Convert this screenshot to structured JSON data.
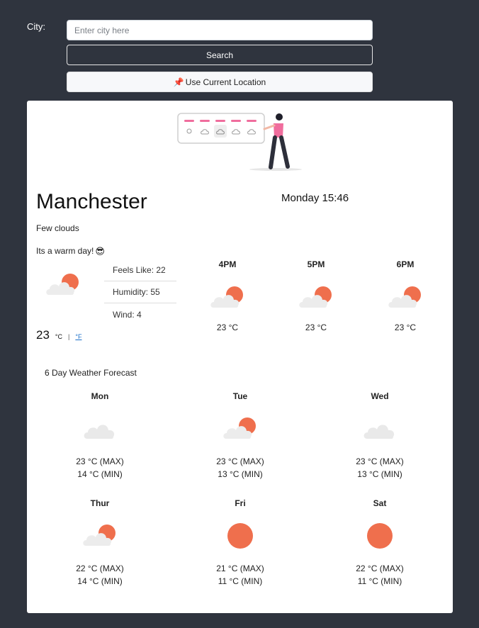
{
  "search": {
    "city_label": "City:",
    "input_value": "",
    "input_placeholder": "Enter city here",
    "search_label": "Search",
    "location_icon": "pushpin-icon",
    "location_label": "Use Current Location"
  },
  "colors": {
    "page_bg": "#2f343e",
    "sun": "#ef6f4d",
    "cloud": "#e8e8e8",
    "link": "#1a6fc9"
  },
  "weather": {
    "city": "Manchester",
    "datetime": "Monday 15:46",
    "description": "Few clouds",
    "remark": "Its a warm day!",
    "remark_emoji": "😎",
    "icon": "few-clouds-icon",
    "feels_like": "Feels Like: 22",
    "humidity": "Humidity: 55",
    "wind": "Wind: 4",
    "temp": "23",
    "unit_c": "°C",
    "unit_sep": "|",
    "unit_f": "°F"
  },
  "hourly": [
    {
      "time": "4PM",
      "icon": "few-clouds-icon",
      "temp": "23 °C"
    },
    {
      "time": "5PM",
      "icon": "few-clouds-icon",
      "temp": "23 °C"
    },
    {
      "time": "6PM",
      "icon": "few-clouds-icon",
      "temp": "23 °C"
    }
  ],
  "forecast": {
    "title": "6 Day Weather Forecast",
    "days": [
      {
        "day": "Mon",
        "icon": "clouds-icon",
        "max": "23 °C (MAX)",
        "min": "14 °C (MIN)"
      },
      {
        "day": "Tue",
        "icon": "few-clouds-icon",
        "max": "23 °C (MAX)",
        "min": "13 °C (MIN)"
      },
      {
        "day": "Wed",
        "icon": "clouds-icon",
        "max": "23 °C (MAX)",
        "min": "13 °C (MIN)"
      },
      {
        "day": "Thur",
        "icon": "few-clouds-icon",
        "max": "22 °C (MAX)",
        "min": "14 °C (MIN)"
      },
      {
        "day": "Fri",
        "icon": "sun-icon",
        "max": "21 °C (MAX)",
        "min": "11 °C (MIN)"
      },
      {
        "day": "Sat",
        "icon": "sun-icon",
        "max": "22 °C (MAX)",
        "min": "11 °C (MIN)"
      }
    ]
  }
}
